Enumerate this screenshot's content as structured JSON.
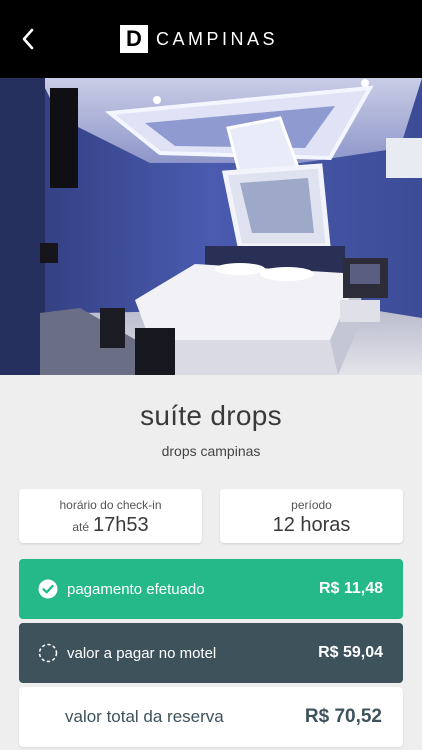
{
  "header": {
    "logo_letter": "D",
    "logo_text": "CAMPINAS",
    "back_icon": "chevron-left-icon"
  },
  "suite": {
    "name": "suíte drops",
    "motel": "drops campinas"
  },
  "checkin": {
    "label": "horário do check-in",
    "prefix": "até",
    "time": "17h53"
  },
  "period": {
    "label": "período",
    "value": "12 horas"
  },
  "payment": {
    "paid_label": "pagamento efetuado",
    "paid_amount": "R$ 11,48",
    "paid_icon": "check-circle-icon",
    "motel_label": "valor a pagar no motel",
    "motel_amount": "R$ 59,04",
    "motel_icon": "dashed-circle-icon",
    "total_label": "valor total da reserva",
    "total_amount": "R$ 70,52"
  },
  "colors": {
    "header_bg": "#000000",
    "paid_bg": "#25b989",
    "motel_bg": "#3e525c",
    "page_bg": "#eeeeee"
  }
}
